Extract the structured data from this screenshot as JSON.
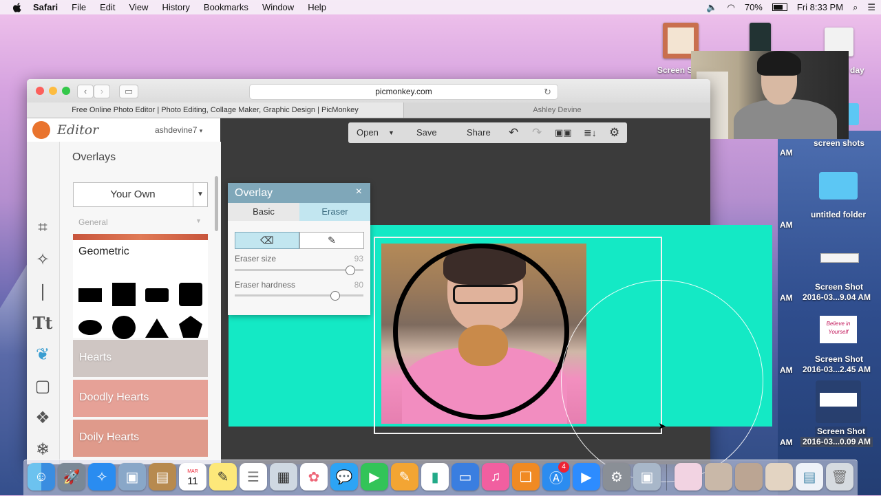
{
  "menubar": {
    "app": "Safari",
    "items": [
      "File",
      "Edit",
      "View",
      "History",
      "Bookmarks",
      "Window",
      "Help"
    ],
    "battery": "70%",
    "clock": "Fri 8:33 PM"
  },
  "desktop": {
    "labels": {
      "screen_shots_partial": "Screen S",
      "day_partial": "day",
      "am_1": "AM",
      "screen_shots": "screen shots",
      "am_2": "AM",
      "untitled_folder": "untitled folder",
      "am_3": "AM",
      "shot1_title": "Screen Shot",
      "shot1_sub": "2016-03...9.04 AM",
      "am_4": "AM",
      "shot2_title": "Screen Shot",
      "shot2_sub": "2016-03...2.45 AM",
      "am_5": "AM",
      "shot3_title": "Screen Shot",
      "shot3_sub": "2016-03...0.09 AM",
      "am_6": "AM",
      "believe_text": "Believe in Yourself"
    }
  },
  "safari": {
    "url": "picmonkey.com",
    "tab1": "Free Online Photo Editor | Photo Editing, Collage Maker, Graphic Design | PicMonkey",
    "tab2": "Ashley Devine"
  },
  "editor": {
    "logo": "Editor",
    "user": "ashdevine7",
    "panel_title": "Overlays",
    "dropdown_label": "Your Own",
    "general_label": "General",
    "geometric_title": "Geometric",
    "categories": [
      {
        "label": "Hearts",
        "color": "#d2c9c6"
      },
      {
        "label": "Doodly Hearts",
        "color": "#e8a299"
      },
      {
        "label": "Doily Hearts",
        "color": "#e09a8c"
      }
    ]
  },
  "toolbar": {
    "open": "Open",
    "save": "Save",
    "share": "Share"
  },
  "overlay_dialog": {
    "title": "Overlay",
    "close": "×",
    "tab_basic": "Basic",
    "tab_eraser": "Eraser",
    "eraser_size_label": "Eraser size",
    "eraser_size_value": "93",
    "eraser_size_fraction": 0.93,
    "eraser_hardness_label": "Eraser hardness",
    "eraser_hardness_value": "80",
    "eraser_hardness_fraction": 0.8
  },
  "dock": {
    "calendar_month": "MAR",
    "calendar_day": "11",
    "appstore_badge": "4"
  },
  "colors": {
    "canvas_bg": "#14e9c5",
    "dialog_header": "#7fa7b9",
    "eraser_tab": "#c2e6f0"
  }
}
